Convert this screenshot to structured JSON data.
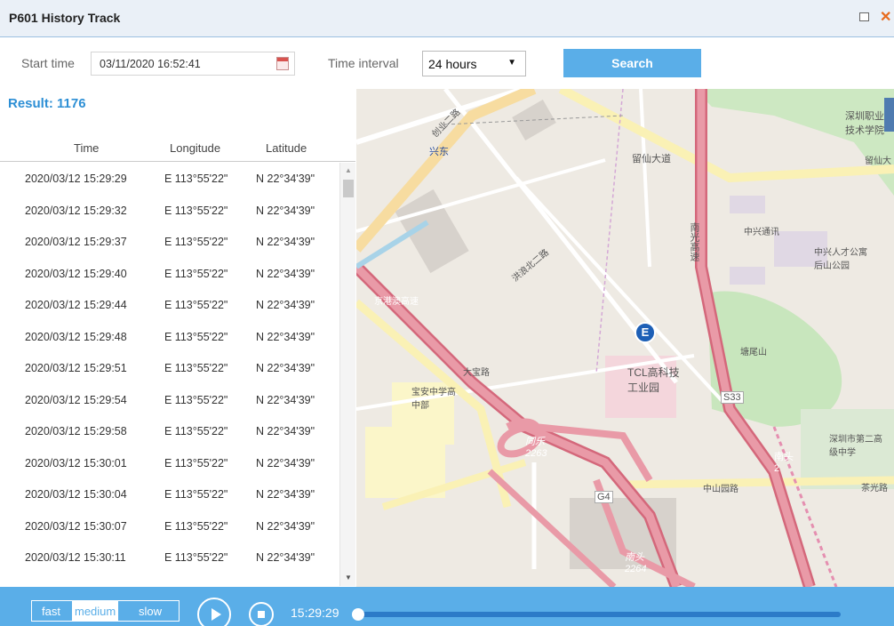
{
  "window": {
    "title": "P601  History Track"
  },
  "toolbar": {
    "start_label": "Start time",
    "start_value": "03/11/2020 16:52:41",
    "interval_label": "Time interval",
    "interval_value": "24 hours",
    "search_label": "Search"
  },
  "results": {
    "title": "Result: 1176",
    "columns": [
      "Time",
      "Longitude",
      "Latitude"
    ],
    "rows": [
      [
        "2020/03/12 15:29:29",
        "E 113°55'22\"",
        "N 22°34'39\""
      ],
      [
        "2020/03/12 15:29:32",
        "E 113°55'22\"",
        "N 22°34'39\""
      ],
      [
        "2020/03/12 15:29:37",
        "E 113°55'22\"",
        "N 22°34'39\""
      ],
      [
        "2020/03/12 15:29:40",
        "E 113°55'22\"",
        "N 22°34'39\""
      ],
      [
        "2020/03/12 15:29:44",
        "E 113°55'22\"",
        "N 22°34'39\""
      ],
      [
        "2020/03/12 15:29:48",
        "E 113°55'22\"",
        "N 22°34'39\""
      ],
      [
        "2020/03/12 15:29:51",
        "E 113°55'22\"",
        "N 22°34'39\""
      ],
      [
        "2020/03/12 15:29:54",
        "E 113°55'22\"",
        "N 22°34'39\""
      ],
      [
        "2020/03/12 15:29:58",
        "E 113°55'22\"",
        "N 22°34'39\""
      ],
      [
        "2020/03/12 15:30:01",
        "E 113°55'22\"",
        "N 22°34'39\""
      ],
      [
        "2020/03/12 15:30:04",
        "E 113°55'22\"",
        "N 22°34'39\""
      ],
      [
        "2020/03/12 15:30:07",
        "E 113°55'22\"",
        "N 22°34'39\""
      ],
      [
        "2020/03/12 15:30:11",
        "E 113°55'22\"",
        "N 22°34'39\""
      ]
    ]
  },
  "map": {
    "marker": "E",
    "labels": [
      "兴东",
      "留仙大道",
      "南光高速",
      "中兴通讯",
      "中兴人才公寓后山公园",
      "塘尾山",
      "TCL高科技工业园",
      "S33",
      "宝安中学高中部",
      "京港澳高速",
      "同乐 2263",
      "G4",
      "中山园路",
      "南头 2",
      "南头 2264",
      "深圳市第二高级中学",
      "茶光路",
      "留仙大",
      "深圳职业技术学院",
      "大宝路",
      "洪浪北二路",
      "创业二路"
    ]
  },
  "playback": {
    "speeds": [
      "fast",
      "medium",
      "slow"
    ],
    "selected_speed": "medium",
    "current_time": "15:29:29",
    "progress": 0.0
  },
  "colors": {
    "accent": "#5aaee8",
    "result_title": "#2d8fd5",
    "close": "#e86a1c"
  }
}
